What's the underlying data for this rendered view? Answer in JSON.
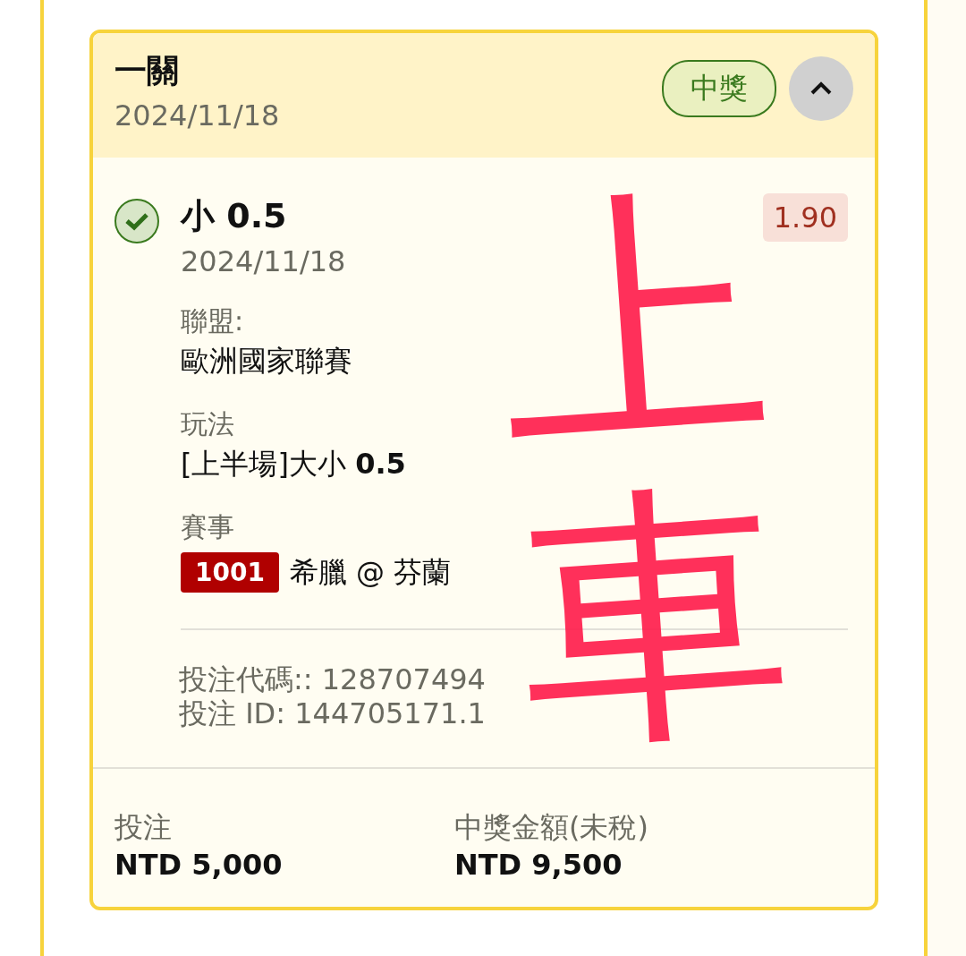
{
  "bet_card": {
    "title": "一關",
    "date": "2024/11/18",
    "status_badge": "中獎",
    "expanded": true,
    "selection": {
      "name": "小 0.5",
      "date": "2024/11/18",
      "odds": "1.90",
      "won": true
    },
    "details": [
      {
        "label": "聯盟:",
        "value": "歐洲國家聯賽"
      },
      {
        "label": "玩法",
        "value": "[上半場]大小 **0.5**"
      }
    ],
    "event": {
      "label": "賽事",
      "code": "1001",
      "teams": "希臘 @ 芬蘭"
    },
    "bet_code": "投注代碼:: 128707494",
    "bet_id": "投注 ID: 144705171.1",
    "stake": {
      "label": "投注",
      "value": "NTD 5,000"
    },
    "payout": {
      "label": "中獎金額(未稅)",
      "value": "NTD 9,500"
    }
  },
  "handwritten_note": "上車"
}
